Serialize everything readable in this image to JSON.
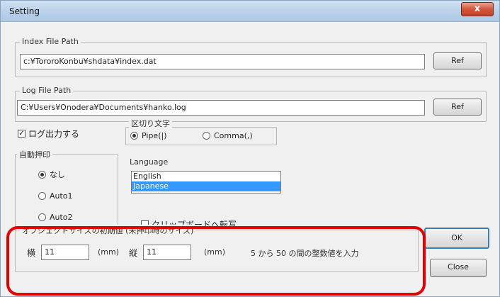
{
  "window": {
    "title": "Setting",
    "close_glyph": "x"
  },
  "index_group": {
    "label": "Index File Path",
    "value": "c:¥TororoKonbu¥shdata¥index.dat",
    "ref_label": "Ref"
  },
  "log_group": {
    "label": "Log File Path",
    "value": "C:¥Users¥Onodera¥Documents¥hanko.log",
    "ref_label": "Ref"
  },
  "log_output": {
    "label": "ログ出力する",
    "checked": true,
    "glyph": "✓"
  },
  "delimiter": {
    "label": "区切り文字",
    "options": [
      {
        "label": "Pipe(|)",
        "selected": true
      },
      {
        "label": "Comma(,)",
        "selected": false
      }
    ]
  },
  "auto_stamp": {
    "label": "自動押印",
    "options": [
      {
        "label": "なし",
        "selected": true
      },
      {
        "label": "Auto1",
        "selected": false
      },
      {
        "label": "Auto2",
        "selected": false
      }
    ]
  },
  "language": {
    "label": "Language",
    "items": [
      {
        "label": "English",
        "selected": false
      },
      {
        "label": "Japanese",
        "selected": true
      }
    ]
  },
  "clipboard": {
    "label": "クリップボードへ転写"
  },
  "object_size": {
    "label": "オブジェクトサイズの初期値 (未押印時のサイズ)",
    "width_label": "横",
    "width_value": "11",
    "width_unit": "(mm)",
    "height_label": "縦",
    "height_value": "11",
    "height_unit": "(mm)",
    "hint": "5 から 50 の間の整数値を入力"
  },
  "buttons": {
    "ok": "OK",
    "close": "Close"
  },
  "colors": {
    "highlight": "#e30000",
    "selection": "#3399ff"
  }
}
